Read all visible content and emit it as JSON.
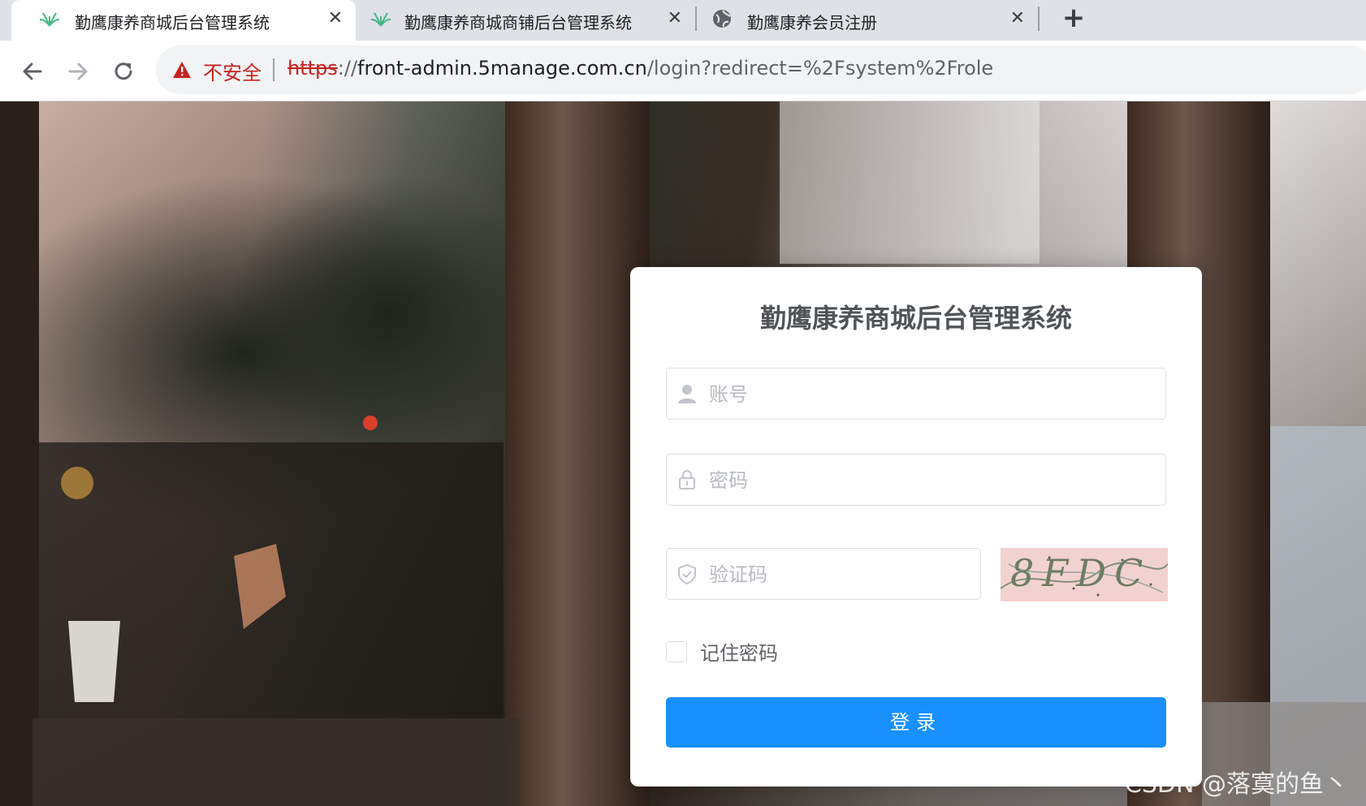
{
  "browser": {
    "tabs": [
      {
        "title": "勤鹰康养商城后台管理系统",
        "icon": "leaf-favicon-icon",
        "close": "✕",
        "active": true
      },
      {
        "title": "勤鹰康养商城商铺后台管理系统",
        "icon": "leaf-favicon-icon",
        "close": "✕",
        "active": false
      },
      {
        "title": "勤鹰康养会员注册",
        "icon": "globe-icon",
        "close": "✕",
        "active": false
      }
    ],
    "new_tab": "+",
    "security_label": "不安全",
    "url": {
      "scheme": "https",
      "separator": "://",
      "host": "front-admin.5manage.com.cn",
      "path": "/login?redirect=%2Fsystem%2Frole"
    }
  },
  "login": {
    "title": "勤鹰康养商城后台管理系统",
    "username_placeholder": "账号",
    "password_placeholder": "密码",
    "captcha_placeholder": "验证码",
    "captcha_text": "8FDC",
    "remember_label": "记住密码",
    "submit_label": "登录"
  },
  "watermark": "CSDN @落寞的鱼丶",
  "colors": {
    "primary": "#1890ff",
    "insecure": "#c5221f",
    "tab_bar": "#dee1e6"
  }
}
